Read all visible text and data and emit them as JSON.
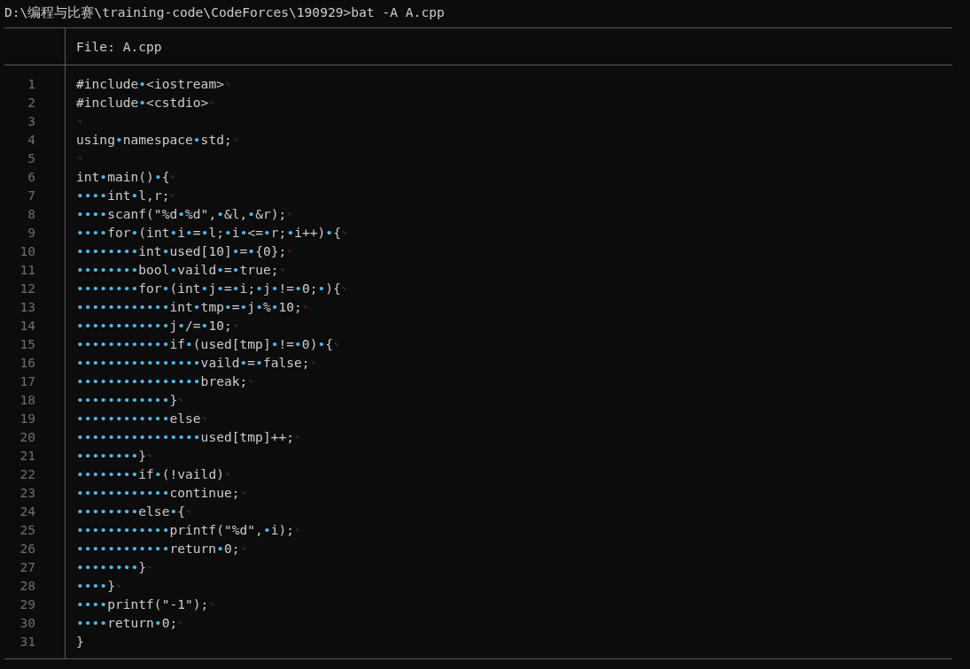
{
  "prompt": "D:\\编程与比赛\\training-code\\CodeForces\\190929>bat -A A.cpp",
  "file_label": "File: A.cpp",
  "lines": [
    {
      "number": "1",
      "segments": [
        {
          "kind": "text",
          "text": "#include"
        },
        {
          "kind": "space",
          "text": "•"
        },
        {
          "kind": "text",
          "text": "<iostream>"
        },
        {
          "kind": "eol",
          "text": "␊"
        }
      ]
    },
    {
      "number": "2",
      "segments": [
        {
          "kind": "text",
          "text": "#include"
        },
        {
          "kind": "space",
          "text": "•"
        },
        {
          "kind": "text",
          "text": "<cstdio>"
        },
        {
          "kind": "eol",
          "text": "␊"
        }
      ]
    },
    {
      "number": "3",
      "segments": [
        {
          "kind": "eol",
          "text": "␊"
        }
      ]
    },
    {
      "number": "4",
      "segments": [
        {
          "kind": "text",
          "text": "using"
        },
        {
          "kind": "space",
          "text": "•"
        },
        {
          "kind": "text",
          "text": "namespace"
        },
        {
          "kind": "space",
          "text": "•"
        },
        {
          "kind": "text",
          "text": "std;"
        },
        {
          "kind": "eol",
          "text": "␊"
        }
      ]
    },
    {
      "number": "5",
      "segments": [
        {
          "kind": "eol",
          "text": "␊"
        }
      ]
    },
    {
      "number": "6",
      "segments": [
        {
          "kind": "text",
          "text": "int"
        },
        {
          "kind": "space",
          "text": "•"
        },
        {
          "kind": "text",
          "text": "main()"
        },
        {
          "kind": "space",
          "text": "•"
        },
        {
          "kind": "text",
          "text": "{"
        },
        {
          "kind": "eol",
          "text": "␊"
        }
      ]
    },
    {
      "number": "7",
      "segments": [
        {
          "kind": "space",
          "text": "••••"
        },
        {
          "kind": "text",
          "text": "int"
        },
        {
          "kind": "space",
          "text": "•"
        },
        {
          "kind": "text",
          "text": "l,r;"
        },
        {
          "kind": "eol",
          "text": "␊"
        }
      ]
    },
    {
      "number": "8",
      "segments": [
        {
          "kind": "space",
          "text": "••••"
        },
        {
          "kind": "text",
          "text": "scanf(\"%d"
        },
        {
          "kind": "space",
          "text": "•"
        },
        {
          "kind": "text",
          "text": "%d\","
        },
        {
          "kind": "space",
          "text": "•"
        },
        {
          "kind": "text",
          "text": "&l,"
        },
        {
          "kind": "space",
          "text": "•"
        },
        {
          "kind": "text",
          "text": "&r);"
        },
        {
          "kind": "eol",
          "text": "␊"
        }
      ]
    },
    {
      "number": "9",
      "segments": [
        {
          "kind": "space",
          "text": "••••"
        },
        {
          "kind": "text",
          "text": "for"
        },
        {
          "kind": "space",
          "text": "•"
        },
        {
          "kind": "text",
          "text": "(int"
        },
        {
          "kind": "space",
          "text": "•"
        },
        {
          "kind": "text",
          "text": "i"
        },
        {
          "kind": "space",
          "text": "•"
        },
        {
          "kind": "text",
          "text": "="
        },
        {
          "kind": "space",
          "text": "•"
        },
        {
          "kind": "text",
          "text": "l;"
        },
        {
          "kind": "space",
          "text": "•"
        },
        {
          "kind": "text",
          "text": "i"
        },
        {
          "kind": "space",
          "text": "•"
        },
        {
          "kind": "text",
          "text": "<="
        },
        {
          "kind": "space",
          "text": "•"
        },
        {
          "kind": "text",
          "text": "r;"
        },
        {
          "kind": "space",
          "text": "•"
        },
        {
          "kind": "text",
          "text": "i++)"
        },
        {
          "kind": "space",
          "text": "•"
        },
        {
          "kind": "text",
          "text": "{"
        },
        {
          "kind": "eol",
          "text": "␊"
        }
      ]
    },
    {
      "number": "10",
      "segments": [
        {
          "kind": "space",
          "text": "••••••••"
        },
        {
          "kind": "text",
          "text": "int"
        },
        {
          "kind": "space",
          "text": "•"
        },
        {
          "kind": "text",
          "text": "used[10]"
        },
        {
          "kind": "space",
          "text": "•"
        },
        {
          "kind": "text",
          "text": "="
        },
        {
          "kind": "space",
          "text": "•"
        },
        {
          "kind": "text",
          "text": "{0};"
        },
        {
          "kind": "eol",
          "text": "␊"
        }
      ]
    },
    {
      "number": "11",
      "segments": [
        {
          "kind": "space",
          "text": "••••••••"
        },
        {
          "kind": "text",
          "text": "bool"
        },
        {
          "kind": "space",
          "text": "•"
        },
        {
          "kind": "text",
          "text": "vaild"
        },
        {
          "kind": "space",
          "text": "•"
        },
        {
          "kind": "text",
          "text": "="
        },
        {
          "kind": "space",
          "text": "•"
        },
        {
          "kind": "text",
          "text": "true;"
        },
        {
          "kind": "eol",
          "text": "␊"
        }
      ]
    },
    {
      "number": "12",
      "segments": [
        {
          "kind": "space",
          "text": "••••••••"
        },
        {
          "kind": "text",
          "text": "for"
        },
        {
          "kind": "space",
          "text": "•"
        },
        {
          "kind": "text",
          "text": "(int"
        },
        {
          "kind": "space",
          "text": "•"
        },
        {
          "kind": "text",
          "text": "j"
        },
        {
          "kind": "space",
          "text": "•"
        },
        {
          "kind": "text",
          "text": "="
        },
        {
          "kind": "space",
          "text": "•"
        },
        {
          "kind": "text",
          "text": "i;"
        },
        {
          "kind": "space",
          "text": "•"
        },
        {
          "kind": "text",
          "text": "j"
        },
        {
          "kind": "space",
          "text": "•"
        },
        {
          "kind": "text",
          "text": "!="
        },
        {
          "kind": "space",
          "text": "•"
        },
        {
          "kind": "text",
          "text": "0;"
        },
        {
          "kind": "space",
          "text": "•"
        },
        {
          "kind": "text",
          "text": "){"
        },
        {
          "kind": "eol",
          "text": "␊"
        }
      ]
    },
    {
      "number": "13",
      "segments": [
        {
          "kind": "space",
          "text": "••••••••••••"
        },
        {
          "kind": "text",
          "text": "int"
        },
        {
          "kind": "space",
          "text": "•"
        },
        {
          "kind": "text",
          "text": "tmp"
        },
        {
          "kind": "space",
          "text": "•"
        },
        {
          "kind": "text",
          "text": "="
        },
        {
          "kind": "space",
          "text": "•"
        },
        {
          "kind": "text",
          "text": "j"
        },
        {
          "kind": "space",
          "text": "•"
        },
        {
          "kind": "text",
          "text": "%"
        },
        {
          "kind": "space",
          "text": "•"
        },
        {
          "kind": "text",
          "text": "10;"
        },
        {
          "kind": "eol",
          "text": "␊"
        }
      ]
    },
    {
      "number": "14",
      "segments": [
        {
          "kind": "space",
          "text": "••••••••••••"
        },
        {
          "kind": "text",
          "text": "j"
        },
        {
          "kind": "space",
          "text": "•"
        },
        {
          "kind": "text",
          "text": "/="
        },
        {
          "kind": "space",
          "text": "•"
        },
        {
          "kind": "text",
          "text": "10;"
        },
        {
          "kind": "eol",
          "text": "␊"
        }
      ]
    },
    {
      "number": "15",
      "segments": [
        {
          "kind": "space",
          "text": "••••••••••••"
        },
        {
          "kind": "text",
          "text": "if"
        },
        {
          "kind": "space",
          "text": "•"
        },
        {
          "kind": "text",
          "text": "(used[tmp]"
        },
        {
          "kind": "space",
          "text": "•"
        },
        {
          "kind": "text",
          "text": "!="
        },
        {
          "kind": "space",
          "text": "•"
        },
        {
          "kind": "text",
          "text": "0)"
        },
        {
          "kind": "space",
          "text": "•"
        },
        {
          "kind": "text",
          "text": "{"
        },
        {
          "kind": "eol",
          "text": "␊"
        }
      ]
    },
    {
      "number": "16",
      "segments": [
        {
          "kind": "space",
          "text": "••••••••••••••••"
        },
        {
          "kind": "text",
          "text": "vaild"
        },
        {
          "kind": "space",
          "text": "•"
        },
        {
          "kind": "text",
          "text": "="
        },
        {
          "kind": "space",
          "text": "•"
        },
        {
          "kind": "text",
          "text": "false;"
        },
        {
          "kind": "eol",
          "text": "␊"
        }
      ]
    },
    {
      "number": "17",
      "segments": [
        {
          "kind": "space",
          "text": "••••••••••••••••"
        },
        {
          "kind": "text",
          "text": "break;"
        },
        {
          "kind": "eol",
          "text": "␊"
        }
      ]
    },
    {
      "number": "18",
      "segments": [
        {
          "kind": "space",
          "text": "••••••••••••"
        },
        {
          "kind": "text",
          "text": "}"
        },
        {
          "kind": "eol",
          "text": "␊"
        }
      ]
    },
    {
      "number": "19",
      "segments": [
        {
          "kind": "space",
          "text": "••••••••••••"
        },
        {
          "kind": "text",
          "text": "else"
        },
        {
          "kind": "eol",
          "text": "␊"
        }
      ]
    },
    {
      "number": "20",
      "segments": [
        {
          "kind": "space",
          "text": "••••••••••••••••"
        },
        {
          "kind": "text",
          "text": "used[tmp]++;"
        },
        {
          "kind": "eol",
          "text": "␊"
        }
      ]
    },
    {
      "number": "21",
      "segments": [
        {
          "kind": "space",
          "text": "••••••••"
        },
        {
          "kind": "text",
          "text": "}"
        },
        {
          "kind": "eol",
          "text": "␊"
        }
      ]
    },
    {
      "number": "22",
      "segments": [
        {
          "kind": "space",
          "text": "••••••••"
        },
        {
          "kind": "text",
          "text": "if"
        },
        {
          "kind": "space",
          "text": "•"
        },
        {
          "kind": "text",
          "text": "(!vaild)"
        },
        {
          "kind": "eol",
          "text": "␊"
        }
      ]
    },
    {
      "number": "23",
      "segments": [
        {
          "kind": "space",
          "text": "••••••••••••"
        },
        {
          "kind": "text",
          "text": "continue;"
        },
        {
          "kind": "eol",
          "text": "␊"
        }
      ]
    },
    {
      "number": "24",
      "segments": [
        {
          "kind": "space",
          "text": "••••••••"
        },
        {
          "kind": "text",
          "text": "else"
        },
        {
          "kind": "space",
          "text": "•"
        },
        {
          "kind": "text",
          "text": "{"
        },
        {
          "kind": "eol",
          "text": "␊"
        }
      ]
    },
    {
      "number": "25",
      "segments": [
        {
          "kind": "space",
          "text": "••••••••••••"
        },
        {
          "kind": "text",
          "text": "printf(\"%d\","
        },
        {
          "kind": "space",
          "text": "•"
        },
        {
          "kind": "text",
          "text": "i);"
        },
        {
          "kind": "eol",
          "text": "␊"
        }
      ]
    },
    {
      "number": "26",
      "segments": [
        {
          "kind": "space",
          "text": "••••••••••••"
        },
        {
          "kind": "text",
          "text": "return"
        },
        {
          "kind": "space",
          "text": "•"
        },
        {
          "kind": "text",
          "text": "0;"
        },
        {
          "kind": "eol",
          "text": "␊"
        }
      ]
    },
    {
      "number": "27",
      "segments": [
        {
          "kind": "space",
          "text": "••••••••"
        },
        {
          "kind": "text",
          "text": "}"
        },
        {
          "kind": "eol",
          "text": "␊"
        }
      ]
    },
    {
      "number": "28",
      "segments": [
        {
          "kind": "space",
          "text": "••••"
        },
        {
          "kind": "text",
          "text": "}"
        },
        {
          "kind": "eol",
          "text": "␊"
        }
      ]
    },
    {
      "number": "29",
      "segments": [
        {
          "kind": "space",
          "text": "••••"
        },
        {
          "kind": "text",
          "text": "printf(\"-1\");"
        },
        {
          "kind": "eol",
          "text": "␊"
        }
      ]
    },
    {
      "number": "30",
      "segments": [
        {
          "kind": "space",
          "text": "••••"
        },
        {
          "kind": "text",
          "text": "return"
        },
        {
          "kind": "space",
          "text": "•"
        },
        {
          "kind": "text",
          "text": "0;"
        },
        {
          "kind": "eol",
          "text": "␊"
        }
      ]
    },
    {
      "number": "31",
      "segments": [
        {
          "kind": "text",
          "text": "}"
        }
      ]
    }
  ]
}
